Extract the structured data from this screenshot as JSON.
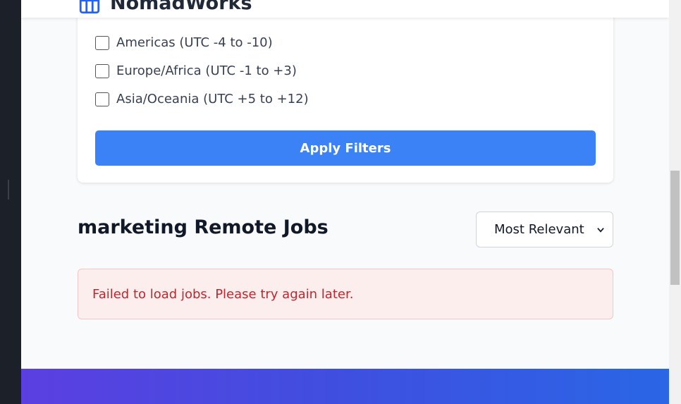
{
  "header": {
    "brand_name": "NomadWorks",
    "brand_icon": "building-icon"
  },
  "filters": {
    "timezones": [
      {
        "label": "Americas (UTC -4 to -10)",
        "checked": false
      },
      {
        "label": "Europe/Africa (UTC -1 to +3)",
        "checked": false
      },
      {
        "label": "Asia/Oceania (UTC +5 to +12)",
        "checked": false
      }
    ],
    "apply_label": "Apply Filters"
  },
  "results": {
    "title": "marketing Remote Jobs",
    "sort_selected": "Most Relevant",
    "error_message": "Failed to load jobs. Please try again later."
  },
  "colors": {
    "accent": "#3b82f6",
    "error_text": "#c0262d",
    "error_bg": "#fdeeee"
  }
}
